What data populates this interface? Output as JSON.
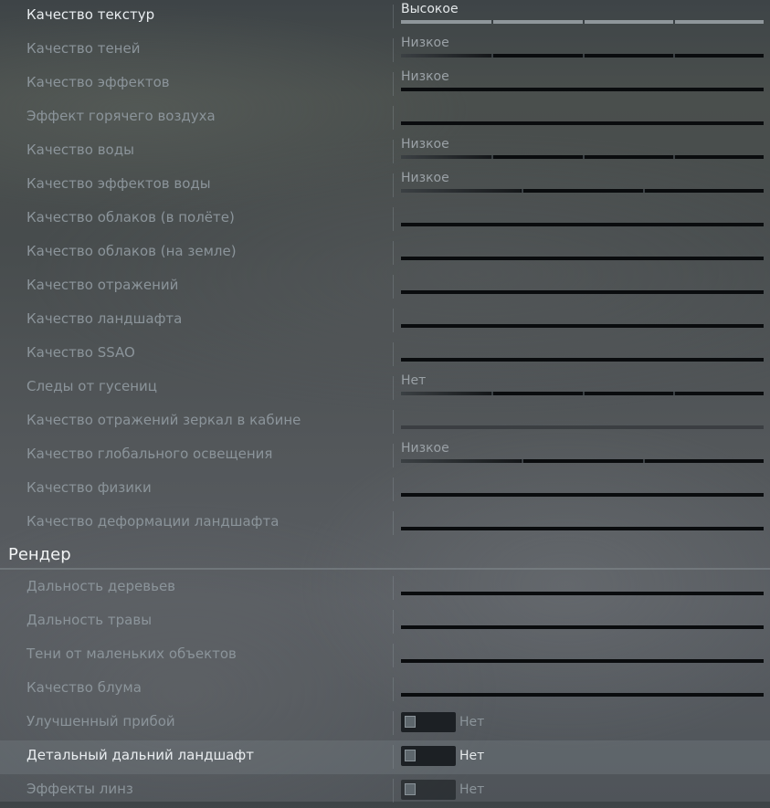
{
  "settings_top": [
    {
      "label": "Качество текстур",
      "value": "Высокое",
      "level": 1.0,
      "bright": true
    },
    {
      "label": "Качество теней",
      "value": "Низкое",
      "level": 0.25
    },
    {
      "label": "Качество эффектов",
      "value": "Низкое",
      "level": 0.0
    },
    {
      "label": "Эффект горячего воздуха",
      "value": "",
      "level": 0.0
    },
    {
      "label": "Качество воды",
      "value": "Низкое",
      "level": 0.25
    },
    {
      "label": "Качество эффектов воды",
      "value": "Низкое",
      "level": 0.33
    },
    {
      "label": "Качество облаков (в полёте)",
      "value": "",
      "level": 0.0
    },
    {
      "label": "Качество облаков (на земле)",
      "value": "",
      "level": 0.0
    },
    {
      "label": "Качество отражений",
      "value": "",
      "level": 0.0
    },
    {
      "label": "Качество ландшафта",
      "value": "",
      "level": 0.0
    },
    {
      "label": "Качество SSAO",
      "value": "",
      "level": 0.0
    },
    {
      "label": "Следы от гусениц",
      "value": "Нет",
      "level": 0.25
    },
    {
      "label": "Качество отражений зеркал в кабине",
      "value": "",
      "level": 0.0,
      "disabled": true
    },
    {
      "label": "Качество глобального освещения",
      "value": "Низкое",
      "level": 0.33
    },
    {
      "label": "Качество физики",
      "value": "",
      "level": 0.0
    },
    {
      "label": "Качество деформации ландшафта",
      "value": "",
      "level": 0.0
    }
  ],
  "section_title": "Рендер",
  "settings_render": [
    {
      "label": "Дальность деревьев",
      "value": "",
      "level": 0.0
    },
    {
      "label": "Дальность травы",
      "value": "",
      "level": 0.0
    },
    {
      "label": "Тени от маленьких объектов",
      "value": "",
      "level": 0.0
    },
    {
      "label": "Качество блума",
      "value": "",
      "level": 0.0
    }
  ],
  "toggles": [
    {
      "label": "Улучшенный прибой",
      "state": "Нет"
    },
    {
      "label": "Детальный дальний ландшафт",
      "state": "Нет",
      "active": true
    },
    {
      "label": "Эффекты линз",
      "state": "Нет",
      "dim": true
    }
  ]
}
